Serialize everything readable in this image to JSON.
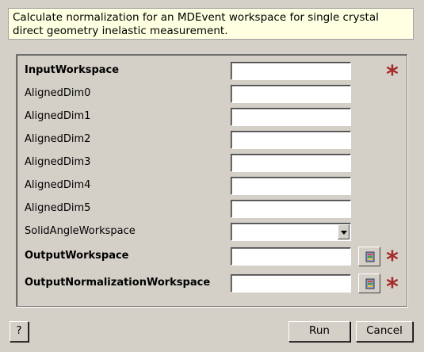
{
  "description": "Calculate normalization for an MDEvent workspace for single crystal direct geometry inelastic measurement.",
  "properties": [
    {
      "label": "InputWorkspace",
      "bold": true,
      "type": "text",
      "value": "",
      "required": true,
      "browse": false
    },
    {
      "label": "AlignedDim0",
      "bold": false,
      "type": "text",
      "value": "",
      "required": false,
      "browse": false
    },
    {
      "label": "AlignedDim1",
      "bold": false,
      "type": "text",
      "value": "",
      "required": false,
      "browse": false
    },
    {
      "label": "AlignedDim2",
      "bold": false,
      "type": "text",
      "value": "",
      "required": false,
      "browse": false
    },
    {
      "label": "AlignedDim3",
      "bold": false,
      "type": "text",
      "value": "",
      "required": false,
      "browse": false
    },
    {
      "label": "AlignedDim4",
      "bold": false,
      "type": "text",
      "value": "",
      "required": false,
      "browse": false
    },
    {
      "label": "AlignedDim5",
      "bold": false,
      "type": "text",
      "value": "",
      "required": false,
      "browse": false
    },
    {
      "label": "SolidAngleWorkspace",
      "bold": false,
      "type": "combo",
      "value": "",
      "required": false,
      "browse": false
    },
    {
      "label": "OutputWorkspace",
      "bold": true,
      "type": "text",
      "value": "",
      "required": true,
      "browse": true
    },
    {
      "label": "OutputNormalizationWorkspace",
      "bold": true,
      "type": "text",
      "value": "",
      "required": true,
      "browse": true
    }
  ],
  "required_marker": "*",
  "buttons": {
    "help": "?",
    "run": "Run",
    "cancel": "Cancel"
  },
  "colors": {
    "required": "#a52a2a",
    "description_bg": "#ffffe1",
    "window_bg": "#d4d0c8"
  }
}
